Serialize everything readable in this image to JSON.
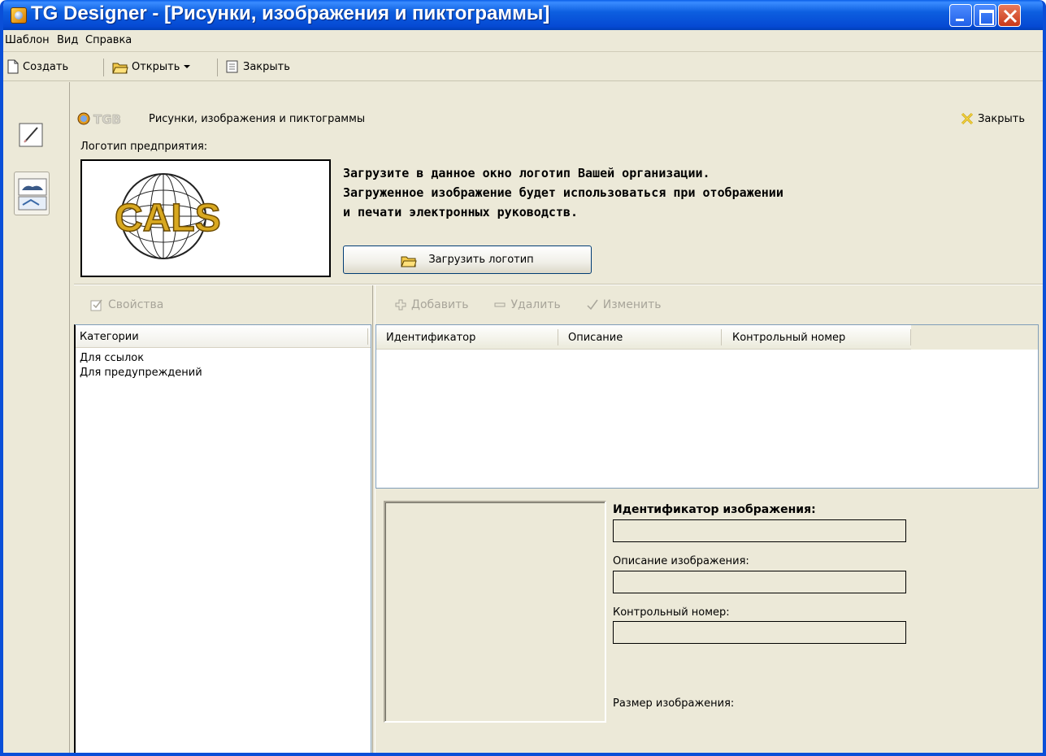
{
  "window": {
    "title": "TG Designer - [Рисунки, изображения и пиктограммы]"
  },
  "menu": [
    "Шаблон",
    "Вид",
    "Справка"
  ],
  "toolbar": {
    "create": "Создать",
    "open": "Открыть",
    "close": "Закрыть"
  },
  "panel": {
    "logo_text": "TGB",
    "title": "Рисунки, изображения и пиктограммы",
    "close": "Закрыть",
    "logo_label": "Логотип предприятия:",
    "logo_image_text": "CALS",
    "message": [
      "Загрузите в данное окно логотип Вашей организации.",
      "Загруженное изображение будет использоваться при отображении",
      "и печати электронных руководств."
    ],
    "upload_button": "Загрузить логотип"
  },
  "left": {
    "properties": "Свойства",
    "column": "Категории",
    "categories": [
      "Для ссылок",
      "Для предупреждений"
    ]
  },
  "actions": {
    "add": "Добавить",
    "delete": "Удалить",
    "edit": "Изменить"
  },
  "grid": {
    "columns": [
      "Идентификатор",
      "Описание",
      "Контрольный номер"
    ]
  },
  "details": {
    "id_label": "Идентификатор изображения:",
    "desc_label": "Описание изображения:",
    "control_label": "Контрольный номер:",
    "size_label": "Размер изображения:"
  },
  "colors": {
    "titlebar": "#0549d3",
    "background": "#ece9d8",
    "border": "#7f9db9"
  }
}
